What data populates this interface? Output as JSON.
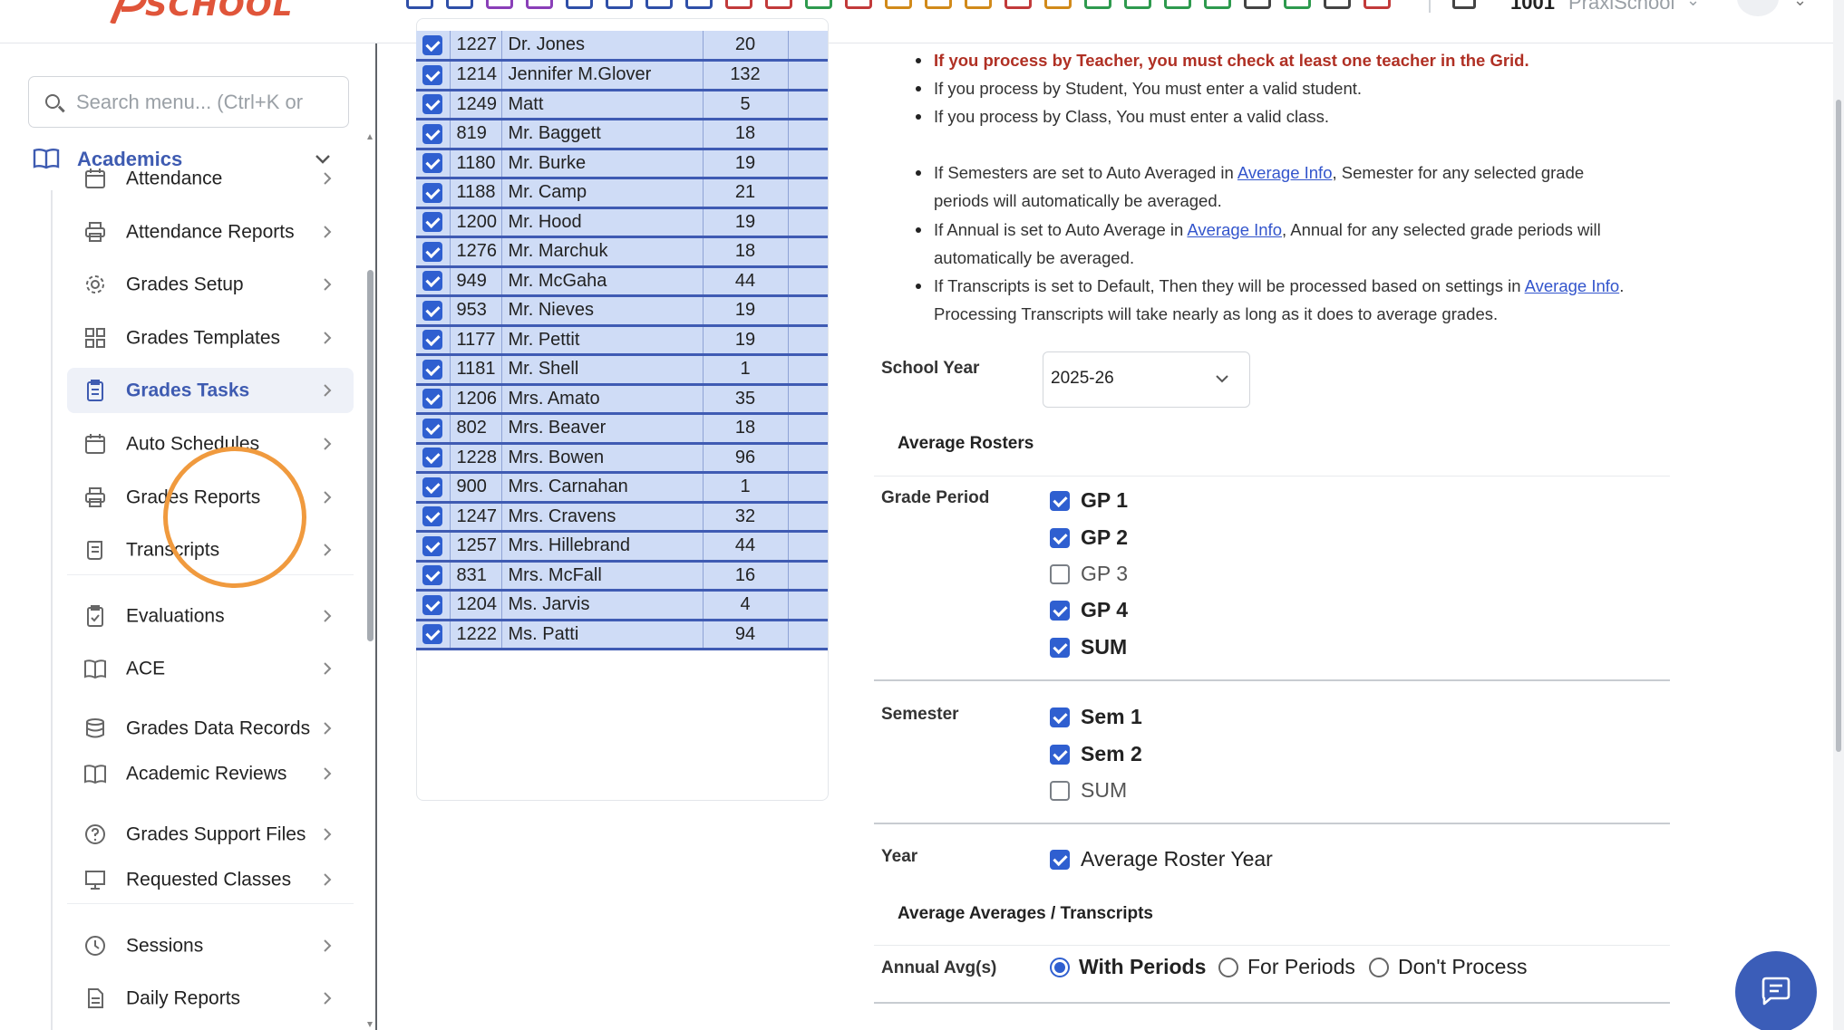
{
  "header": {
    "logo_text": "SCHOOL",
    "school_id": "1001",
    "school_name": "PraxiSchool",
    "toolbar_icon_colors": [
      "#2f4fa8",
      "#2f4fa8",
      "#8a3fb8",
      "#8a3fb8",
      "#2f4fa8",
      "#2f4fa8",
      "#2f4fa8",
      "#2f4fa8",
      "#c23a3a",
      "#c23a3a",
      "#2e9a4e",
      "#c23a3a",
      "#d18a1a",
      "#d18a1a",
      "#d18a1a",
      "#c23a3a",
      "#d18a1a",
      "#2e9a4e",
      "#2e9a4e",
      "#2e9a4e",
      "#2e9a4e",
      "#444444",
      "#2e9a4e",
      "#444444",
      "#c23a3a"
    ]
  },
  "sidebar": {
    "search_placeholder": "Search menu... (Ctrl+K or",
    "section_label": "Academics",
    "items": [
      {
        "label": "Attendance",
        "icon": "calendar-icon"
      },
      {
        "label": "Attendance Reports",
        "icon": "printer-icon"
      },
      {
        "label": "Grades Setup",
        "icon": "gear-icon"
      },
      {
        "label": "Grades Templates",
        "icon": "grid-icon"
      },
      {
        "label": "Grades Tasks",
        "icon": "clipboard-icon",
        "active": true
      },
      {
        "label": "Auto Schedules",
        "icon": "calendar-icon"
      },
      {
        "label": "Grades Reports",
        "icon": "printer-icon"
      },
      {
        "label": "Transcripts",
        "icon": "scroll-icon"
      },
      {
        "label": "Evaluations",
        "icon": "clipboard-check-icon"
      },
      {
        "label": "ACE",
        "icon": "book-icon"
      },
      {
        "label": "Grades Data Records",
        "icon": "database-icon"
      },
      {
        "label": "Academic Reviews",
        "icon": "book-icon"
      },
      {
        "label": "Grades Support Files",
        "icon": "help-circle-icon"
      },
      {
        "label": "Requested Classes",
        "icon": "presentation-icon"
      },
      {
        "label": "Sessions",
        "icon": "clock-icon"
      },
      {
        "label": "Daily Reports",
        "icon": "document-icon"
      }
    ]
  },
  "teacher_grid": {
    "rows": [
      {
        "id": "1227",
        "name": "Dr. Jones",
        "count": "20"
      },
      {
        "id": "1214",
        "name": "Jennifer M.Glover",
        "count": "132"
      },
      {
        "id": "1249",
        "name": "Matt",
        "count": "5"
      },
      {
        "id": "819",
        "name": "Mr. Baggett",
        "count": "18"
      },
      {
        "id": "1180",
        "name": "Mr. Burke",
        "count": "19"
      },
      {
        "id": "1188",
        "name": "Mr. Camp",
        "count": "21"
      },
      {
        "id": "1200",
        "name": "Mr. Hood",
        "count": "19"
      },
      {
        "id": "1276",
        "name": "Mr. Marchuk",
        "count": "18"
      },
      {
        "id": "949",
        "name": "Mr. McGaha",
        "count": "44"
      },
      {
        "id": "953",
        "name": "Mr. Nieves",
        "count": "19"
      },
      {
        "id": "1177",
        "name": "Mr. Pettit",
        "count": "19"
      },
      {
        "id": "1181",
        "name": "Mr. Shell",
        "count": "1"
      },
      {
        "id": "1206",
        "name": "Mrs. Amato",
        "count": "35"
      },
      {
        "id": "802",
        "name": "Mrs. Beaver",
        "count": "18"
      },
      {
        "id": "1228",
        "name": "Mrs. Bowen",
        "count": "96"
      },
      {
        "id": "900",
        "name": "Mrs. Carnahan",
        "count": "1"
      },
      {
        "id": "1247",
        "name": "Mrs. Cravens",
        "count": "32"
      },
      {
        "id": "1257",
        "name": "Mrs. Hillebrand",
        "count": "44"
      },
      {
        "id": "831",
        "name": "Mrs. McFall",
        "count": "16"
      },
      {
        "id": "1204",
        "name": "Ms. Jarvis",
        "count": "4"
      },
      {
        "id": "1222",
        "name": "Ms. Patti",
        "count": "94"
      }
    ]
  },
  "info": {
    "warn_teacher": "If you process by Teacher, you must check at least one teacher in the Grid.",
    "student": "If you process by Student, You must enter a valid student.",
    "class": "If you process by Class, You must enter a valid class.",
    "sem_pre": "If Semesters are set to Auto Averaged in ",
    "sem_link": "Average Info",
    "sem_post": ", Semester for any selected grade periods will automatically be averaged.",
    "annual_pre": "If Annual is set to Auto Average in ",
    "annual_link": "Average Info",
    "annual_post": ", Annual for any selected grade periods will automatically be averaged.",
    "trans_pre": "If Transcripts is set to Default, Then they will be processed based on settings in ",
    "trans_link": "Average Info",
    "trans_post": ". Processing Transcripts will take nearly as long as it does to average grades."
  },
  "form": {
    "school_year_label": "School Year",
    "school_year_value": "2025-26",
    "average_rosters_heading": "Average Rosters",
    "grade_period_label": "Grade Period",
    "grade_periods": [
      {
        "label": "GP 1",
        "checked": true
      },
      {
        "label": "GP 2",
        "checked": true
      },
      {
        "label": "GP 3",
        "checked": false
      },
      {
        "label": "GP 4",
        "checked": true
      },
      {
        "label": "SUM",
        "checked": true
      }
    ],
    "semester_label": "Semester",
    "semesters": [
      {
        "label": "Sem 1",
        "checked": true
      },
      {
        "label": "Sem 2",
        "checked": true
      },
      {
        "label": "SUM",
        "checked": false
      }
    ],
    "year_label": "Year",
    "year_option": "Average Roster Year",
    "averages_heading": "Average Averages / Transcripts",
    "annual_label": "Annual Avg(s)",
    "annual_options": [
      {
        "label": "With Periods",
        "selected": true
      },
      {
        "label": "For Periods",
        "selected": false
      },
      {
        "label": "Don't Process",
        "selected": false
      }
    ]
  }
}
